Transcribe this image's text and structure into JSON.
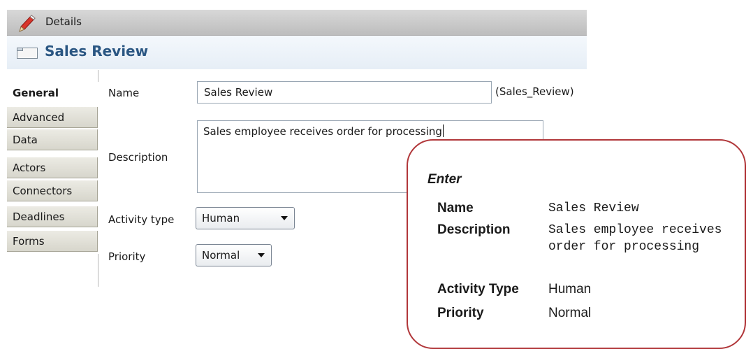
{
  "window": {
    "title": "Details"
  },
  "header": {
    "heading": "Sales Review"
  },
  "tabs": [
    {
      "label": "General",
      "active": true
    },
    {
      "label": "Advanced"
    },
    {
      "label": "Data"
    },
    {
      "label": "Actors"
    },
    {
      "label": "Connectors"
    },
    {
      "label": "Deadlines"
    },
    {
      "label": "Forms"
    }
  ],
  "form": {
    "name_label": "Name",
    "name_value": "Sales Review",
    "name_id": "(Sales_Review)",
    "description_label": "Description",
    "description_value": "Sales employee receives order for processing",
    "activity_type_label": "Activity type",
    "activity_type_value": "Human",
    "priority_label": "Priority",
    "priority_value": "Normal"
  },
  "callout": {
    "heading": "Enter",
    "name_key": "Name",
    "name_val": "Sales Review",
    "description_key": "Description",
    "description_val": "Sales employee receives order for processing",
    "activity_type_key": "Activity Type",
    "activity_type_val": "Human",
    "priority_key": "Priority",
    "priority_val": "Normal"
  },
  "colors": {
    "heading": "#2a5682",
    "callout_border": "#b1373a"
  }
}
